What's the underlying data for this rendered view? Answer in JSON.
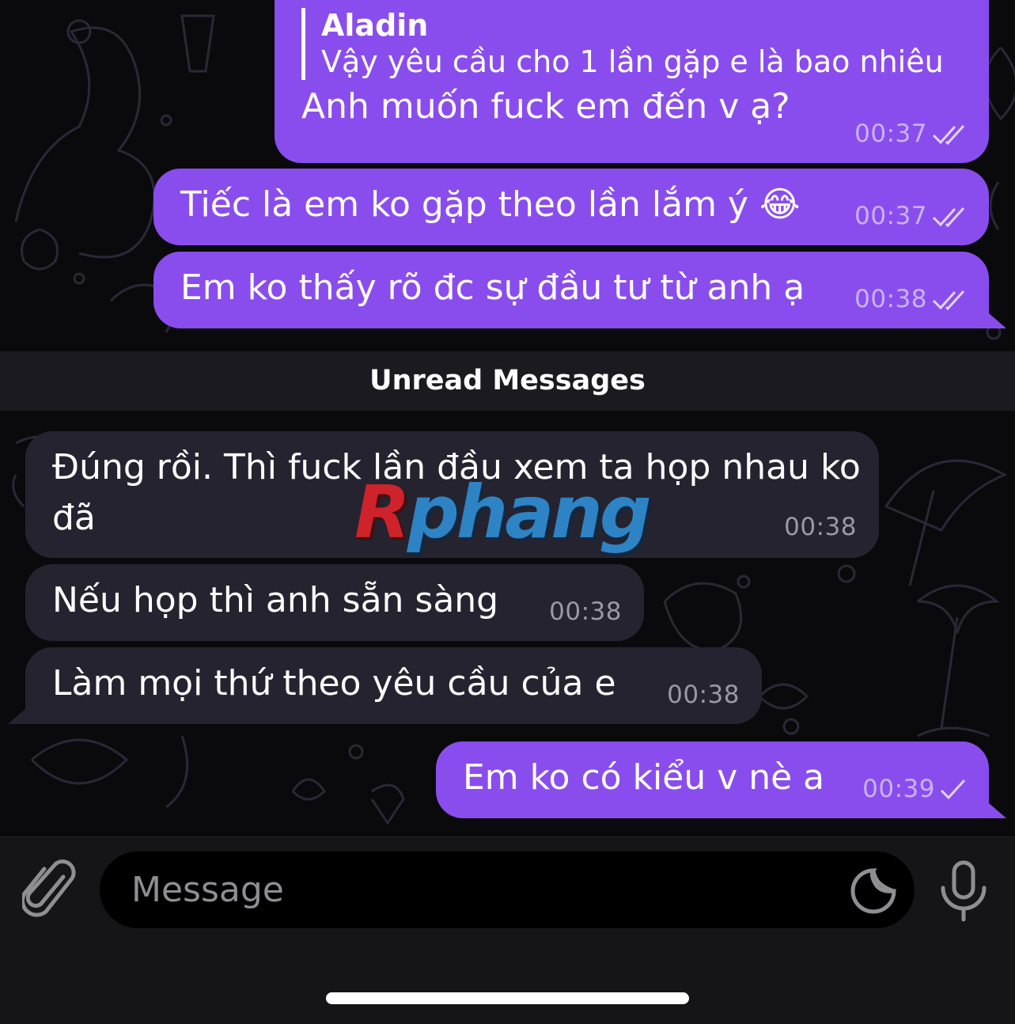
{
  "chat": {
    "messages": [
      {
        "direction": "outgoing",
        "reply_to": {
          "name": "Aladin",
          "text": "Vậy yêu cầu cho 1 lần gặp e là bao nhiêu"
        },
        "text": "Anh muốn fuck em đến v ạ?",
        "time": "00:37",
        "status": "read"
      },
      {
        "direction": "outgoing",
        "text": "Tiếc là em ko gặp theo lần lắm ý 😂",
        "time": "00:37",
        "status": "read"
      },
      {
        "direction": "outgoing",
        "text": "Em ko thấy rõ đc sự đầu tư từ anh ạ",
        "time": "00:38",
        "status": "read"
      },
      {
        "direction": "incoming",
        "text": "Đúng rồi. Thì fuck lần đầu xem ta họp nhau ko đã",
        "time": "00:38"
      },
      {
        "direction": "incoming",
        "text": "Nếu họp thì anh sẵn sàng",
        "time": "00:38"
      },
      {
        "direction": "incoming",
        "text": "Làm mọi thứ theo yêu cầu của e",
        "time": "00:38"
      },
      {
        "direction": "outgoing",
        "text": "Em ko có kiểu v nè a",
        "time": "00:39",
        "status": "sent"
      }
    ],
    "unread_divider": "Unread Messages",
    "watermark": "Rphang"
  },
  "composer": {
    "placeholder": "Message",
    "attach_icon": "paperclip-icon",
    "sticker_icon": "sticker-icon",
    "mic_icon": "microphone-icon"
  },
  "colors": {
    "outgoing_bubble": "#8a4ded",
    "incoming_bubble": "#25232f",
    "background": "#0a0a0d"
  }
}
